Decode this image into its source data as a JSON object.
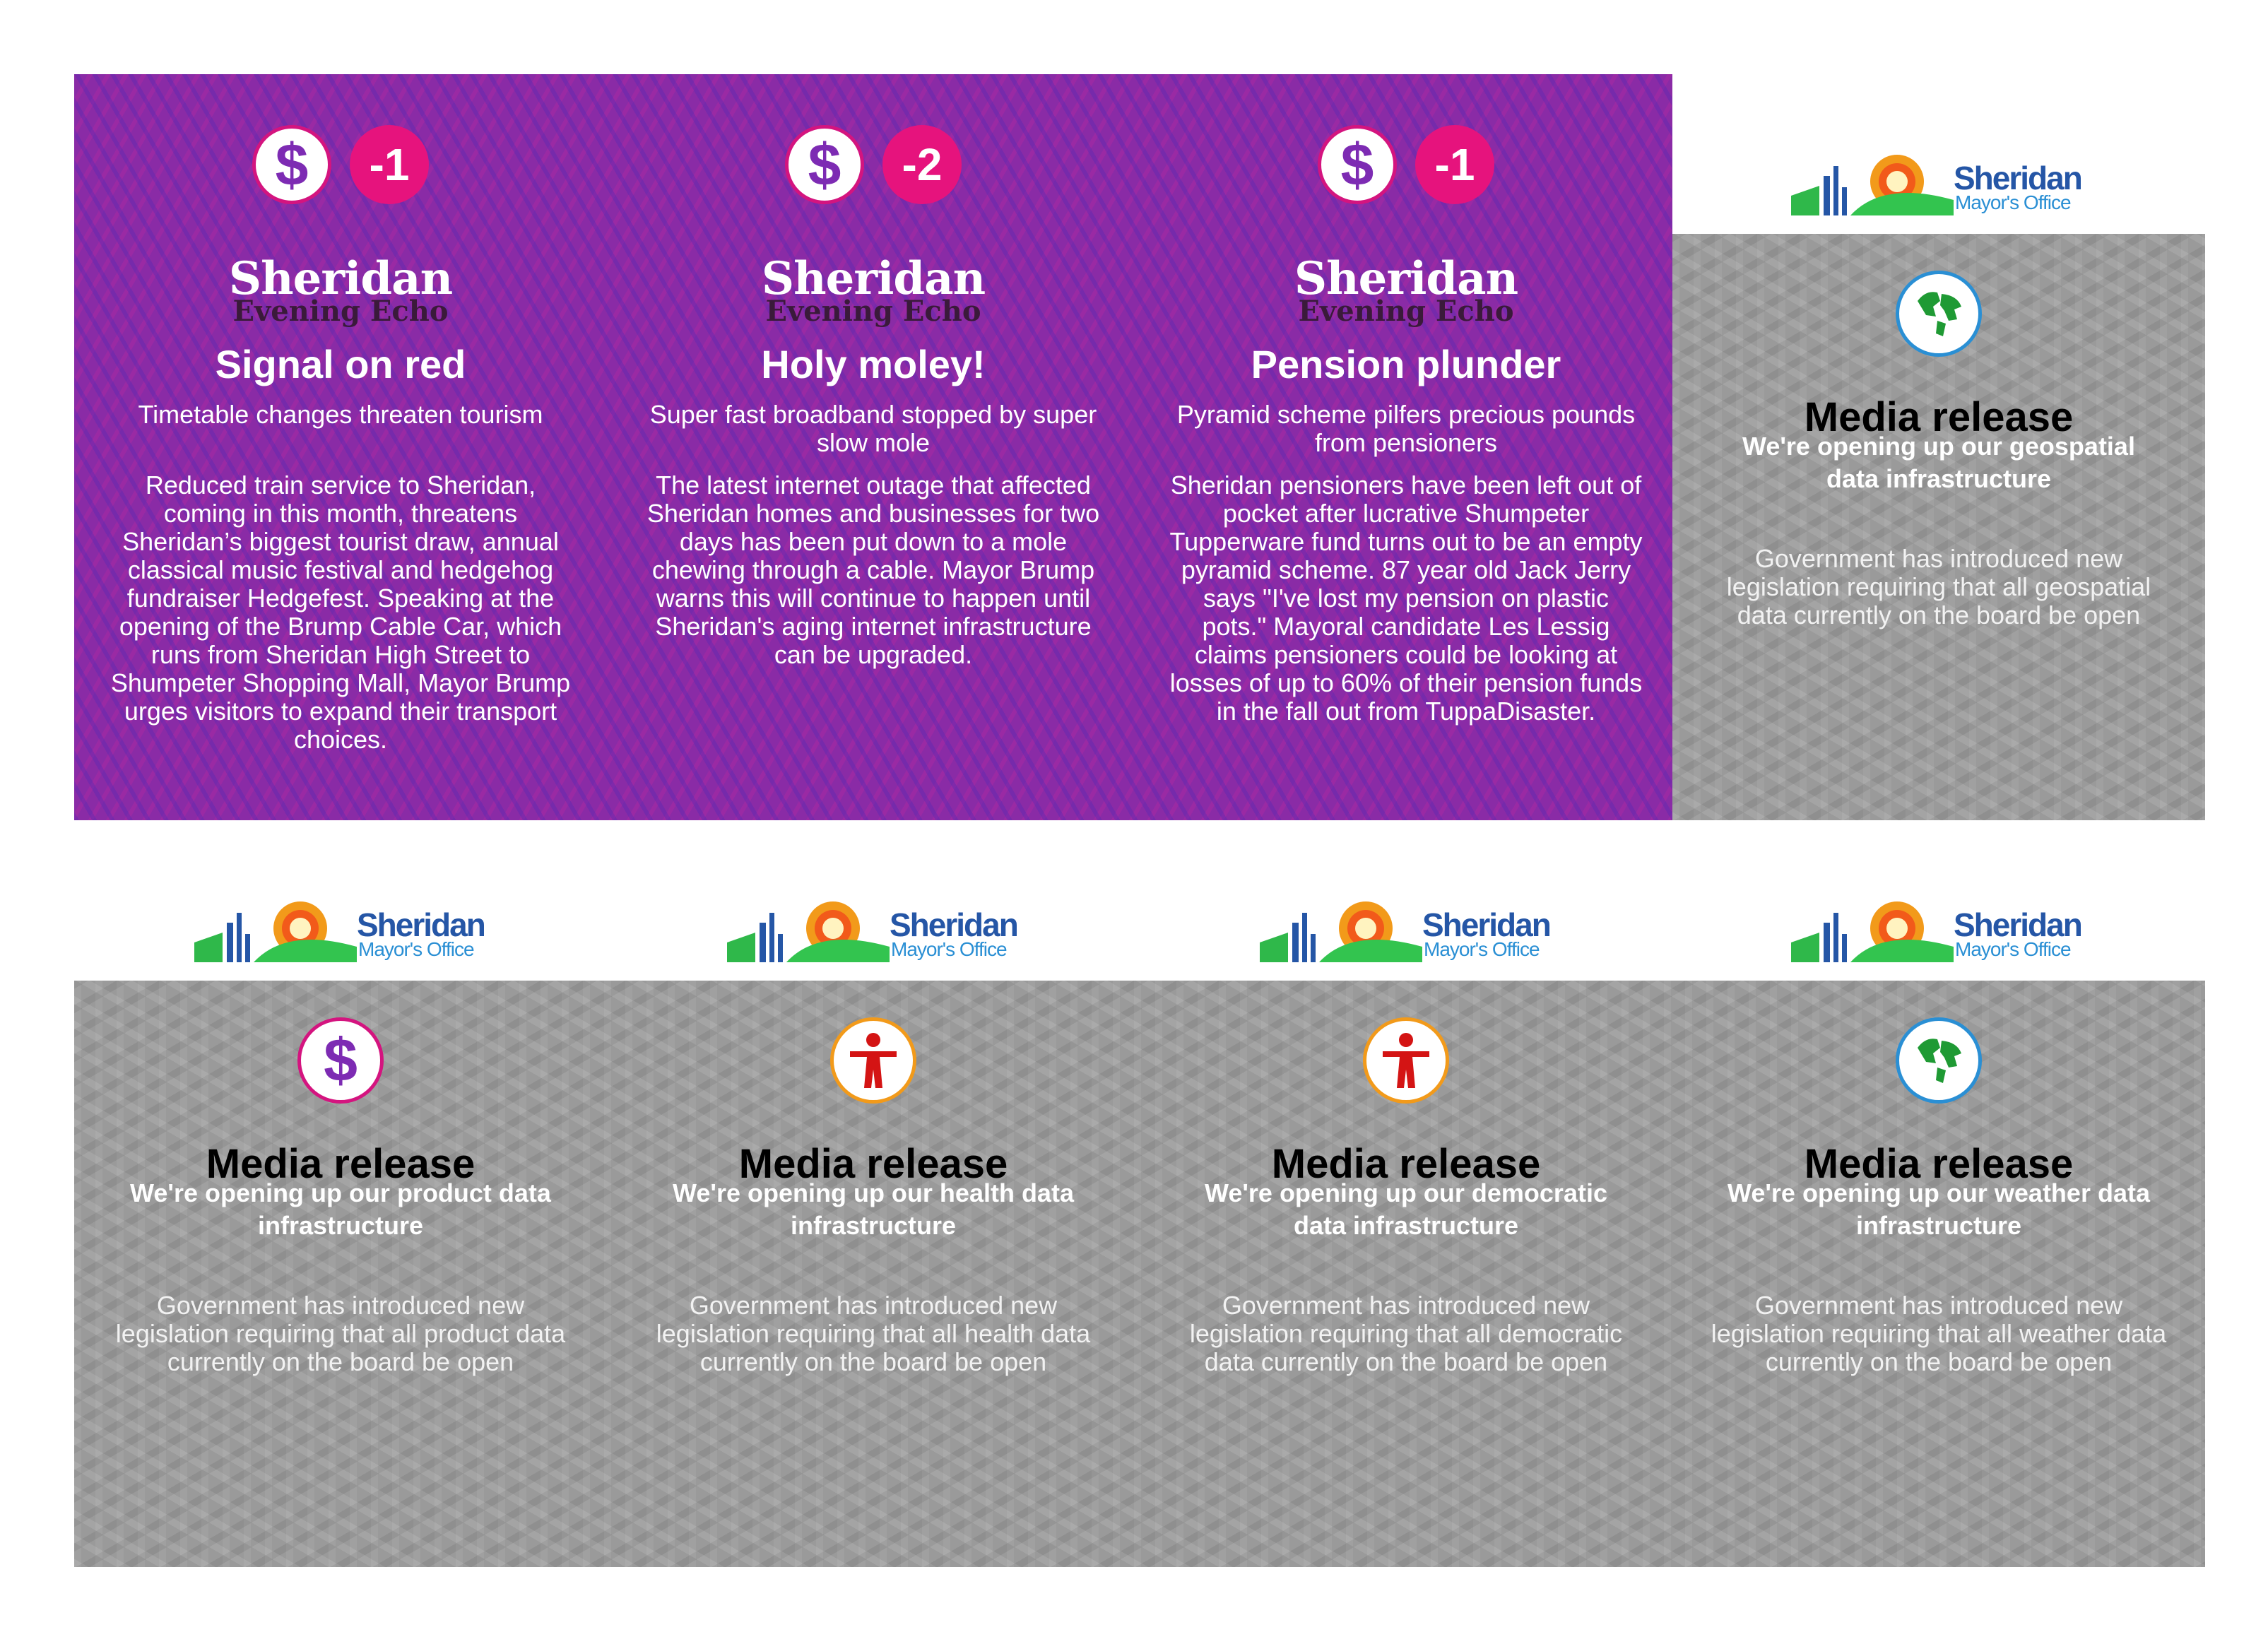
{
  "newspaper": {
    "masthead_top": "Sheridan",
    "masthead_bottom": "Evening Echo",
    "cards": [
      {
        "score": "-1",
        "headline": "Signal on red",
        "subhead": "Timetable changes threaten tourism",
        "body": "Reduced train service to Sheridan, coming in this month, threatens Sheridan’s biggest tourist draw, annual classical music festival and hedgehog fundraiser Hedgefest. Speaking at the opening of the Brump Cable Car, which runs from Sheridan High Street to Shumpeter Shopping Mall, Mayor Brump urges visitors to expand their transport choices."
      },
      {
        "score": "-2",
        "headline": "Holy moley!",
        "subhead": "Super fast broadband stopped by super slow mole",
        "body": "The latest internet outage that affected Sheridan homes and businesses for two days has been put down to a mole chewing through a cable. Mayor Brump warns this will continue to happen until Sheridan's aging internet infrastructure can be upgraded."
      },
      {
        "score": "-1",
        "headline": "Pension plunder",
        "subhead": "Pyramid scheme pilfers precious pounds from pensioners",
        "body": "Sheridan pensioners have been left out of pocket after lucrative Shumpeter Tupperware fund turns out to be an empty pyramid scheme. 87 year old Jack Jerry says \"I've lost my pension on plastic pots.\" Mayoral candidate Les Lessig claims pensioners could be looking at losses of up to 60% of their pension funds in the fall out from TuppaDisaster."
      }
    ]
  },
  "logo": {
    "name": "Sheridan",
    "sub": "Mayor's Office"
  },
  "releases": [
    {
      "icon": "globe-icon",
      "title": "Media release",
      "subtitle": "We're opening up our geospatial data infrastructure",
      "body": "Government has introduced new legislation requiring that all geospatial data currently on the board be open"
    },
    {
      "icon": "dollar-icon",
      "title": "Media release",
      "subtitle": "We're opening up our product data infrastructure",
      "body": "Government has introduced new legislation requiring that all product data currently on the board be open"
    },
    {
      "icon": "person-icon",
      "title": "Media release",
      "subtitle": "We're opening up our health data infrastructure",
      "body": "Government has introduced new legislation requiring that all health data currently on the board be open"
    },
    {
      "icon": "person-icon",
      "title": "Media release",
      "subtitle": "We're opening up our democratic data infrastructure",
      "body": "Government has introduced new legislation requiring that all democratic data currently on the board be open"
    },
    {
      "icon": "globe-icon",
      "title": "Media release",
      "subtitle": "We're opening up our weather data infrastructure",
      "body": "Government has introduced new legislation requiring that all weather data currently on the board be open"
    }
  ],
  "colors": {
    "purple": "#8a2ba6",
    "pink": "#e6137d",
    "grey": "#9a9a9a",
    "logo_blue": "#2556a6"
  }
}
